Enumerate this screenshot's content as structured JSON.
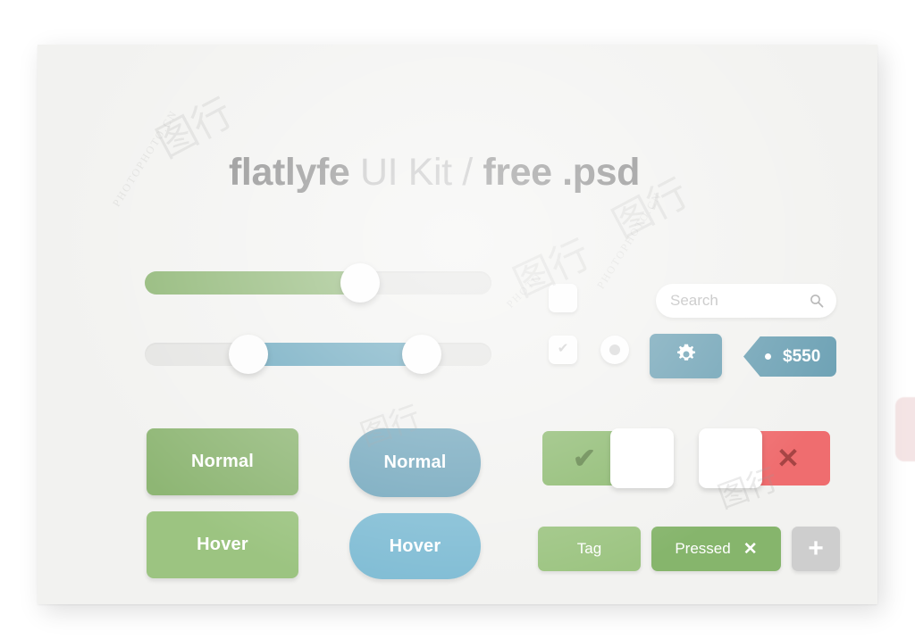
{
  "card": {
    "background_color": "#f2f2f0"
  },
  "title": {
    "part1": "flatlyfe",
    "part2": " UI Kit / ",
    "part3": "free .psd"
  },
  "sliders": [
    {
      "name": "green-slider",
      "type": "single",
      "value_percent": 62,
      "fill_color": "#8eb674",
      "track_color": "#e4e4e2",
      "handle_color": "#fdfdfd"
    },
    {
      "name": "blue-range-slider",
      "type": "range",
      "start_percent": 30,
      "end_percent": 80,
      "fill_color": "#68a6bd",
      "track_color": "#e4e4e2",
      "handle_color": "#fdfdfd"
    }
  ],
  "controls": {
    "checkbox_unchecked": {
      "label": "",
      "checked": false
    },
    "checkbox_checked": {
      "glyph": "✔",
      "checked": true
    },
    "radio_selected": {
      "selected": true
    }
  },
  "search": {
    "placeholder": "Search",
    "value": "",
    "icon": "search-icon"
  },
  "gear_button": {
    "icon": "gear-icon",
    "color": "#6ea2b5"
  },
  "price_tag": {
    "label": "$550",
    "color": "#6ea2b5"
  },
  "buttons": [
    {
      "label": "Normal",
      "style": "green-rect",
      "color": "#8eb674"
    },
    {
      "label": "Hover",
      "style": "green-rect",
      "color": "#9cc481"
    },
    {
      "label": "Normal",
      "style": "blue-pill",
      "color": "#71a6bc"
    },
    {
      "label": "Hover",
      "style": "blue-pill",
      "color": "#7fbcd4"
    }
  ],
  "toggles": [
    {
      "state": "on",
      "glyph": "✔",
      "track_color": "#8dba70",
      "glyph_color": "#5f8347"
    },
    {
      "state": "off",
      "glyph": "✕",
      "track_color": "#ef6d6f",
      "glyph_color": "#a64444"
    }
  ],
  "tags": {
    "normal": {
      "label": "Tag",
      "color": "#9cc481"
    },
    "pressed": {
      "label": "Pressed",
      "close_glyph": "✕",
      "color": "#86b56c"
    },
    "add": {
      "label": "+",
      "color": "#cecece"
    }
  },
  "watermarks": {
    "text_a": "PHOTOPHOTO.CN",
    "text_b": "PHOTOPHOTO.CN",
    "text_c": "PHOTO",
    "logo": "图行"
  }
}
